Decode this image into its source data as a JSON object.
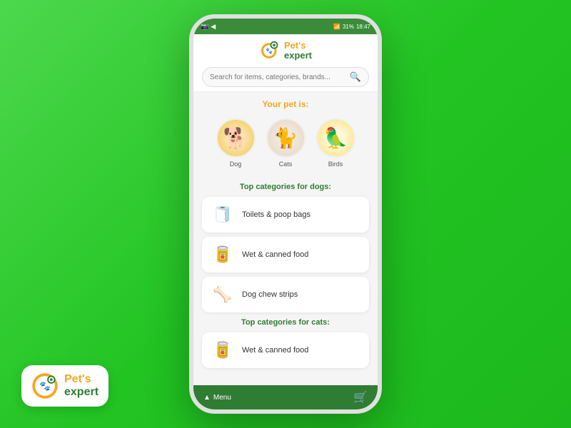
{
  "app": {
    "title": "Pet's Expert",
    "logo_pets": "Pet's",
    "logo_expert": "expert"
  },
  "statusBar": {
    "time": "18:47",
    "battery": "31%",
    "signal": "📶"
  },
  "search": {
    "placeholder": "Search for items, categories, brands..."
  },
  "yourPet": {
    "title": "Your pet is:",
    "pets": [
      {
        "label": "Dog",
        "emoji": "🐕"
      },
      {
        "label": "Cats",
        "emoji": "🐈"
      },
      {
        "label": "Birds",
        "emoji": "🦜"
      }
    ]
  },
  "dogCategories": {
    "title": "Top categories for dogs:",
    "items": [
      {
        "label": "Toilets & poop bags",
        "emoji": "🧻"
      },
      {
        "label": "Wet & canned food",
        "emoji": "🥫"
      },
      {
        "label": "Dog chew strips",
        "emoji": "🦴"
      }
    ]
  },
  "catCategories": {
    "title": "Top categories for cats:",
    "items": [
      {
        "label": "Wet & canned food",
        "emoji": "🥫"
      }
    ]
  },
  "bottomBar": {
    "menuLabel": "Menu",
    "cartIcon": "🛒"
  },
  "watermark": {
    "pets": "Pet's",
    "expert": "expert"
  }
}
